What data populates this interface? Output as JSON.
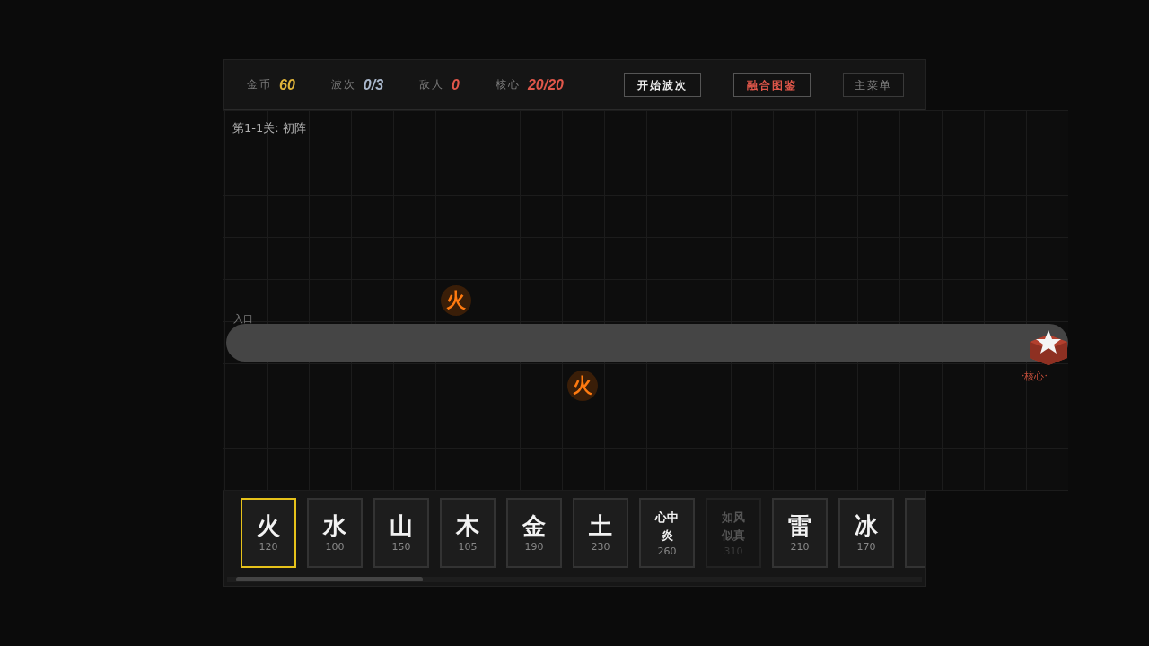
{
  "stats": [
    {
      "label": "金币",
      "value": "60",
      "color": "#e0b43a"
    },
    {
      "label": "波次",
      "value": "0/3",
      "color": "#aab8cc"
    },
    {
      "label": "敌人",
      "value": "0",
      "color": "#e0574a"
    },
    {
      "label": "核心",
      "value": "20/20",
      "color": "#e0574a"
    }
  ],
  "buttons": [
    {
      "label": "开始波次",
      "kind": "primary"
    },
    {
      "label": "融合图鉴",
      "kind": "accent"
    },
    {
      "label": "主菜单",
      "kind": "muted"
    }
  ],
  "level_title": "第1-1关: 初阵",
  "entry_label": "入口",
  "core_label": "·核心·",
  "towers": [
    {
      "glyph": "火"
    },
    {
      "glyph": "火"
    }
  ],
  "cards": [
    {
      "name": "火",
      "cost": "120",
      "selected": true,
      "disabled": false
    },
    {
      "name": "水",
      "cost": "100",
      "selected": false,
      "disabled": false
    },
    {
      "name": "山",
      "cost": "150",
      "selected": false,
      "disabled": false
    },
    {
      "name": "木",
      "cost": "105",
      "selected": false,
      "disabled": false
    },
    {
      "name": "金",
      "cost": "190",
      "selected": false,
      "disabled": false
    },
    {
      "name": "土",
      "cost": "230",
      "selected": false,
      "disabled": false
    },
    {
      "name": "心中炎",
      "cost": "260",
      "selected": false,
      "disabled": false
    },
    {
      "name": "如风似真",
      "cost": "310",
      "selected": false,
      "disabled": true
    },
    {
      "name": "雷",
      "cost": "210",
      "selected": false,
      "disabled": false
    },
    {
      "name": "冰",
      "cost": "170",
      "selected": false,
      "disabled": false
    }
  ]
}
